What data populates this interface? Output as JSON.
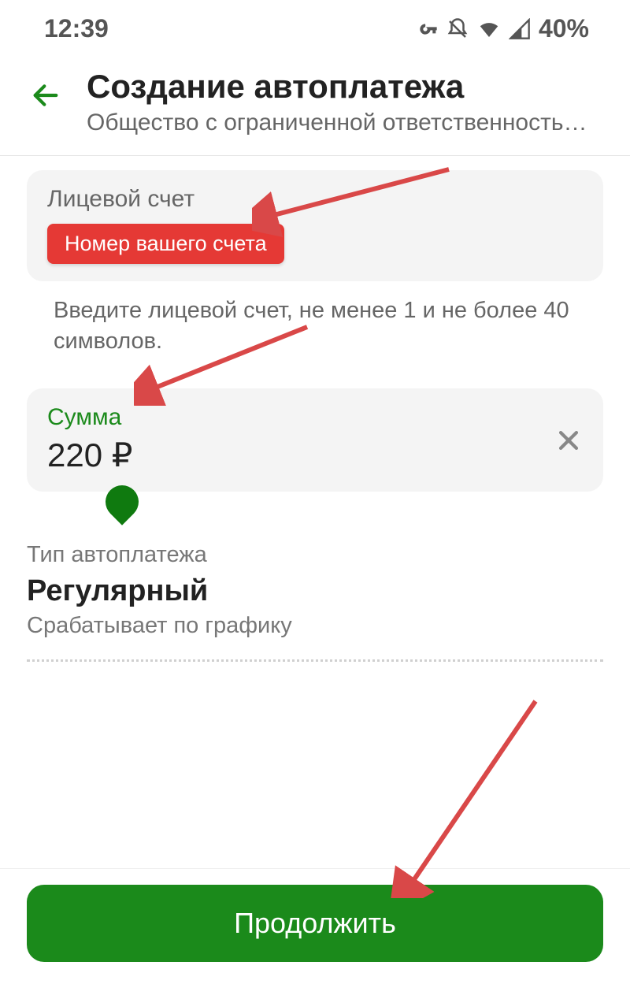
{
  "statusbar": {
    "time": "12:39",
    "battery": "40%"
  },
  "header": {
    "title": "Создание автоплатежа",
    "subtitle": "Общество с ограниченной ответственностью…"
  },
  "account": {
    "label": "Лицевой счет",
    "chip": "Номер вашего счета",
    "hint": "Введите лицевой счет, не менее 1 и не более 40 символов."
  },
  "amount": {
    "label": "Сумма",
    "value": "220 ₽"
  },
  "type": {
    "label": "Тип автоплатежа",
    "value": "Регулярный",
    "sub": "Срабатывает по графику"
  },
  "footer": {
    "continue": "Продолжить"
  }
}
